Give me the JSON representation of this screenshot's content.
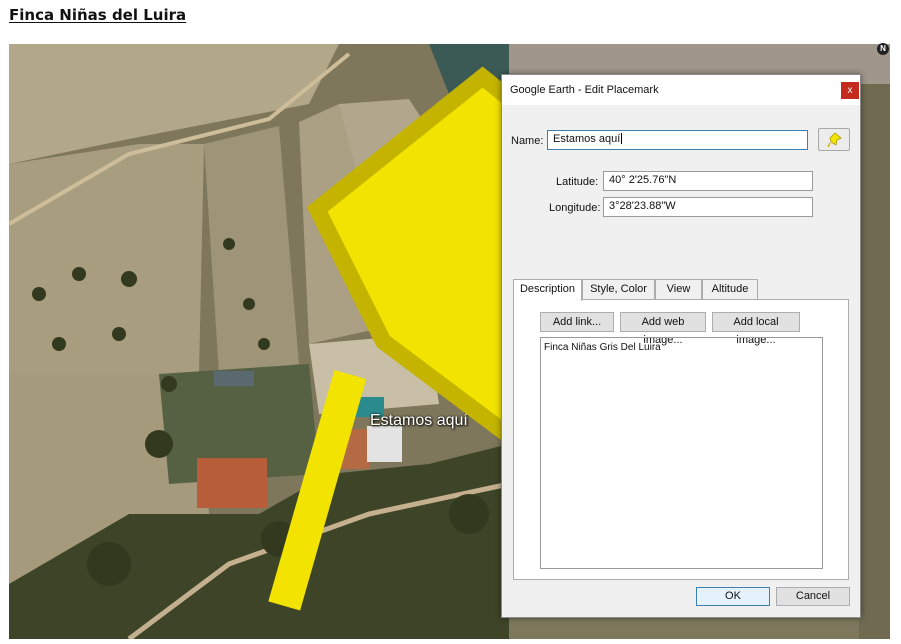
{
  "document": {
    "title": "Finca Niñas del Luira"
  },
  "map": {
    "placemark_label": "Estamos aquí",
    "compass_label": "N",
    "pin_color": "#f2e400"
  },
  "dialog": {
    "title": "Google Earth - Edit Placemark",
    "close_label": "x",
    "name_label": "Name:",
    "name_value": "Estamos aquí",
    "latitude_label": "Latitude:",
    "latitude_value": "40° 2'25.76\"N",
    "longitude_label": "Longitude:",
    "longitude_value": "3°28'23.88\"W",
    "tabs": [
      {
        "label": "Description",
        "selected": true
      },
      {
        "label": "Style, Color",
        "selected": false
      },
      {
        "label": "View",
        "selected": false
      },
      {
        "label": "Altitude",
        "selected": false
      }
    ],
    "add_link_label": "Add link...",
    "add_web_image_label": "Add web image...",
    "add_local_image_label": "Add local image...",
    "description_text": "Finca Niñas Gris Del Luira",
    "ok_label": "OK",
    "cancel_label": "Cancel"
  }
}
